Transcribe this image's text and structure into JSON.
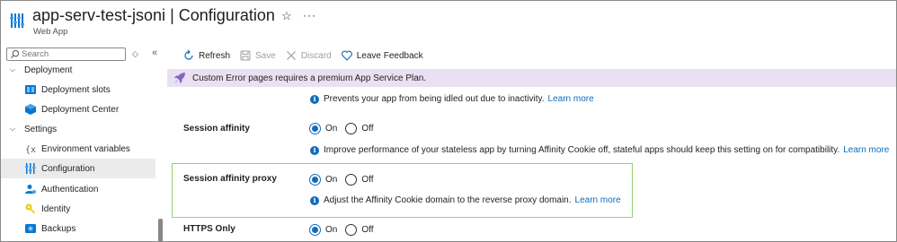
{
  "header": {
    "resource_name": "app-serv-test-jsoni",
    "separator": "|",
    "blade_title": "Configuration",
    "resource_type": "Web App",
    "favorite_icon": "star-icon",
    "more_icon": "more-icon"
  },
  "sidebar": {
    "search_placeholder": "Search",
    "items": [
      {
        "type": "group",
        "label": "Deployment",
        "expanded": true
      },
      {
        "type": "item",
        "label": "Deployment slots",
        "icon": "deployment-slots-icon"
      },
      {
        "type": "item",
        "label": "Deployment Center",
        "icon": "deployment-center-icon"
      },
      {
        "type": "group",
        "label": "Settings",
        "expanded": true
      },
      {
        "type": "item",
        "label": "Environment variables",
        "icon": "environment-variables-icon"
      },
      {
        "type": "item",
        "label": "Configuration",
        "icon": "configuration-icon",
        "selected": true
      },
      {
        "type": "item",
        "label": "Authentication",
        "icon": "authentication-icon"
      },
      {
        "type": "item",
        "label": "Identity",
        "icon": "identity-icon"
      },
      {
        "type": "item",
        "label": "Backups",
        "icon": "backups-icon"
      }
    ]
  },
  "toolbar": {
    "refresh": "Refresh",
    "save": "Save",
    "discard": "Discard",
    "feedback": "Leave Feedback"
  },
  "banner": {
    "text": "Custom Error pages requires a premium App Service Plan.",
    "color": "#e9e0f2"
  },
  "settings": {
    "always_on_info": "Prevents your app from being idled out due to inactivity.",
    "learn_more": "Learn more",
    "session_affinity": {
      "label": "Session affinity",
      "on": "On",
      "off": "Off",
      "value": "On",
      "info": "Improve performance of your stateless app by turning Affinity Cookie off, stateful apps should keep this setting on for compatibility."
    },
    "session_affinity_proxy": {
      "label": "Session affinity proxy",
      "on": "On",
      "off": "Off",
      "value": "On",
      "info": "Adjust the Affinity Cookie domain to the reverse proxy domain."
    },
    "https_only": {
      "label": "HTTPS Only",
      "on": "On",
      "off": "Off",
      "value": "On"
    }
  },
  "colors": {
    "accent": "#0f6cbd",
    "highlight": "#92d36e",
    "selected_bg": "#ebebeb"
  }
}
